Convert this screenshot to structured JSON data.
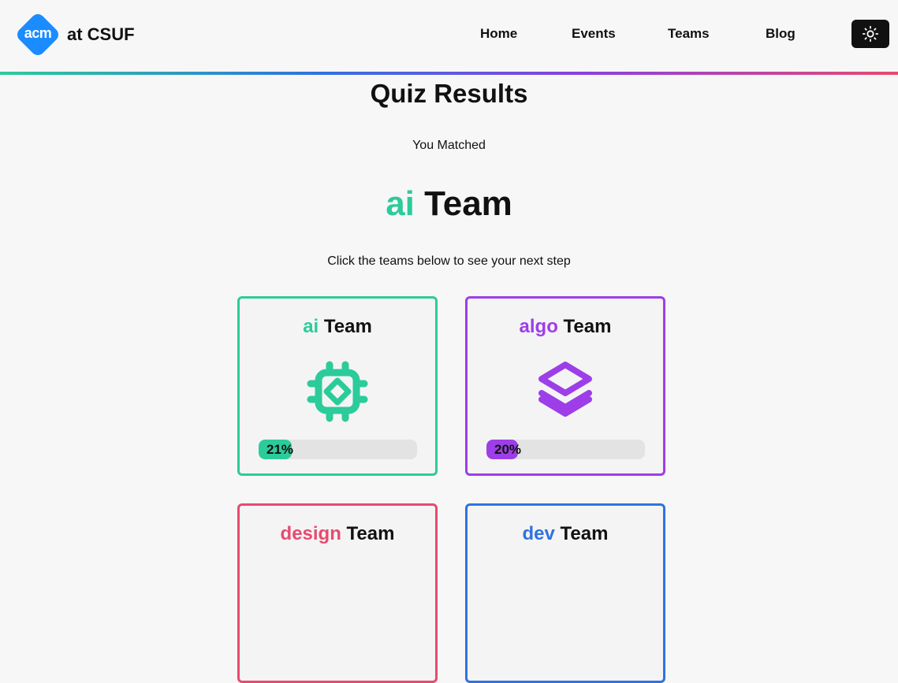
{
  "header": {
    "logo_badge": "acm",
    "logo_text": "at CSUF",
    "nav": [
      "Home",
      "Events",
      "Teams",
      "Blog"
    ],
    "theme_toggle_icon": "sun-icon"
  },
  "main": {
    "title": "Quiz Results",
    "matched_label": "You Matched",
    "matched_team": {
      "name": "ai",
      "suffix": "Team",
      "color": "#2ccb9a"
    },
    "hint": "Click the teams below to see your next step",
    "cards": [
      {
        "name": "ai",
        "suffix": "Team",
        "color": "#2ccb9a",
        "icon": "chip-icon",
        "percent": 21,
        "percent_label": "21%"
      },
      {
        "name": "algo",
        "suffix": "Team",
        "color": "#9d3ee8",
        "icon": "stack-icon",
        "percent": 20,
        "percent_label": "20%"
      },
      {
        "name": "design",
        "suffix": "Team",
        "color": "#e84a6f",
        "icon": "",
        "percent": null,
        "percent_label": ""
      },
      {
        "name": "dev",
        "suffix": "Team",
        "color": "#2f73e0",
        "icon": "",
        "percent": null,
        "percent_label": ""
      }
    ]
  },
  "colors": {
    "brand_blue": "#1a8cff",
    "ai": "#2ccb9a",
    "algo": "#9d3ee8",
    "design": "#e84a6f",
    "dev": "#2f73e0"
  }
}
